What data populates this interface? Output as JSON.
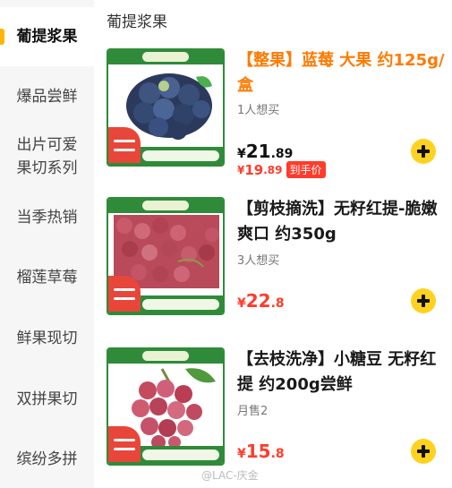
{
  "sidebar": {
    "items": [
      {
        "label": "葡提浆果",
        "active": true
      },
      {
        "label": "爆品尝鲜"
      },
      {
        "label": "出片可爱\n果切系列"
      },
      {
        "label": "当季热销"
      },
      {
        "label": "榴莲草莓"
      },
      {
        "label": "鲜果现切"
      },
      {
        "label": "双拼果切"
      },
      {
        "label": "缤纷多拼"
      }
    ]
  },
  "main": {
    "section_title": "葡提浆果",
    "products": [
      {
        "name": "【整果】蓝莓 大果 约125g/盒",
        "sub": "1人想买",
        "price": {
          "currency": "¥",
          "int": "21",
          "dec": ".89"
        },
        "hand_price": {
          "currency": "¥",
          "int": "19",
          "dec": ".89"
        },
        "hand_tag": "到手价"
      },
      {
        "name": "【剪枝摘洗】无籽红提-脆嫩爽口 约350g",
        "sub": "3人想买",
        "price": {
          "currency": "¥",
          "int": "22",
          "dec": ".8"
        }
      },
      {
        "name": "【去枝洗净】小糖豆 无籽红提 约200g尝鲜",
        "sub": "月售2",
        "price": {
          "currency": "¥",
          "int": "15",
          "dec": ".8"
        }
      }
    ]
  },
  "watermark": "@LAC-庆金",
  "colors": {
    "accent": "#ffd21f",
    "price_red": "#ff3c2c",
    "title_orange": "#ff7a00",
    "brand_green": "#2f8b3a"
  }
}
